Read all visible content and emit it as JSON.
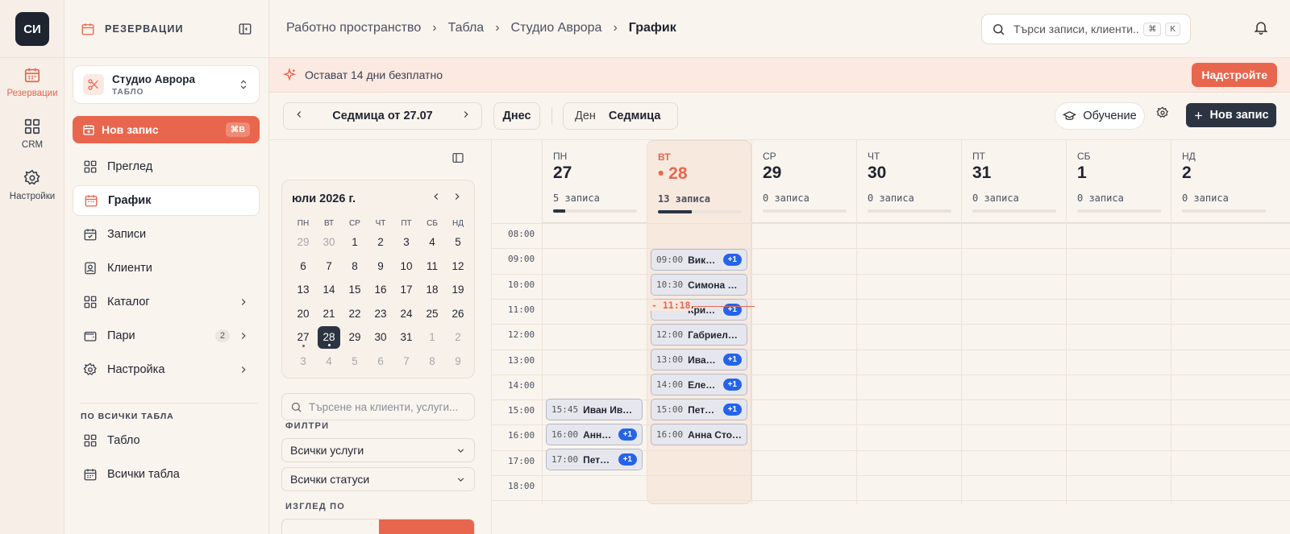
{
  "rail": {
    "logo": "СИ",
    "items": [
      {
        "label": "Резервации",
        "icon": "calendar-icon"
      },
      {
        "label": "CRM",
        "icon": "grid-icon"
      },
      {
        "label": "Настройки",
        "icon": "gear-icon"
      }
    ]
  },
  "sidebar": {
    "title": "РЕЗЕРВАЦИИ",
    "studio": {
      "name": "Студио Аврора",
      "sub": "ТАБЛО"
    },
    "new_button": {
      "label": "Нов запис",
      "shortcut": "⌘B"
    },
    "items": [
      {
        "label": "Преглед"
      },
      {
        "label": "График"
      },
      {
        "label": "Записи"
      },
      {
        "label": "Клиенти"
      },
      {
        "label": "Каталог"
      },
      {
        "label": "Пари",
        "badge": "2"
      },
      {
        "label": "Настройка"
      }
    ],
    "section_label": "ПО ВСИЧКИ ТАБЛА",
    "section_items": [
      {
        "label": "Табло"
      },
      {
        "label": "Всички табла"
      }
    ]
  },
  "breadcrumb": [
    "Работно пространство",
    "Табла",
    "Студио Аврора",
    "График"
  ],
  "search": {
    "placeholder": "Търси записи, клиенти...",
    "key1": "⌘",
    "key2": "K"
  },
  "banner": {
    "message": "Остават 14 дни безплатно",
    "upgrade": "Надстройте"
  },
  "toolbar": {
    "week_label": "Седмица от 27.07",
    "today": "Днес",
    "view_day": "Ден",
    "view_week": "Седмица",
    "learn": "Обучение",
    "new_record": "Нов запис"
  },
  "mini_calendar": {
    "title": "юли 2026 г.",
    "dow": [
      "ПН",
      "ВТ",
      "СР",
      "ЧТ",
      "ПТ",
      "СБ",
      "НД"
    ],
    "weeks": [
      [
        "29",
        "30",
        "1",
        "2",
        "3",
        "4",
        "5"
      ],
      [
        "6",
        "7",
        "8",
        "9",
        "10",
        "11",
        "12"
      ],
      [
        "13",
        "14",
        "15",
        "16",
        "17",
        "18",
        "19"
      ],
      [
        "20",
        "21",
        "22",
        "23",
        "24",
        "25",
        "26"
      ],
      [
        "27",
        "28",
        "29",
        "30",
        "31",
        "1",
        "2"
      ],
      [
        "3",
        "4",
        "5",
        "6",
        "7",
        "8",
        "9"
      ]
    ]
  },
  "client_search": {
    "placeholder": "Търсене на клиенти, услуги..."
  },
  "filters": {
    "label": "ФИЛТРИ",
    "services": "Всички услуги",
    "statuses": "Всички статуси",
    "view_by": "ИЗГЛЕД ПО"
  },
  "week": {
    "days": [
      {
        "dow": "ПН",
        "num": "27",
        "count": "5 записа",
        "load": 0.14
      },
      {
        "dow": "ВТ",
        "num": "28",
        "count": "13 записа",
        "load": 0.4
      },
      {
        "dow": "СР",
        "num": "29",
        "count": "0 записа",
        "load": 0
      },
      {
        "dow": "ЧТ",
        "num": "30",
        "count": "0 записа",
        "load": 0
      },
      {
        "dow": "ПТ",
        "num": "31",
        "count": "0 записа",
        "load": 0
      },
      {
        "dow": "СБ",
        "num": "1",
        "count": "0 записа",
        "load": 0
      },
      {
        "dow": "НД",
        "num": "2",
        "count": "0 записа",
        "load": 0
      }
    ],
    "hours": [
      "08:00",
      "09:00",
      "10:00",
      "11:00",
      "12:00",
      "13:00",
      "14:00",
      "15:00",
      "16:00",
      "17:00",
      "18:00"
    ],
    "now": "11:18",
    "events": [
      {
        "day": 1,
        "time": "09:00",
        "name": "Виктория Петрова",
        "more": "+1"
      },
      {
        "day": 1,
        "time": "10:30",
        "name": "Симона Николова",
        "more": ""
      },
      {
        "day": 1,
        "time": "11:18",
        "name": "Кристина Иванова",
        "more": "+1"
      },
      {
        "day": 1,
        "time": "12:00",
        "name": "Габриела Маринова",
        "more": ""
      },
      {
        "day": 1,
        "time": "13:00",
        "name": "Иванка Петрова",
        "more": "+1"
      },
      {
        "day": 1,
        "time": "14:00",
        "name": "Елена Димитрова",
        "more": "+1"
      },
      {
        "day": 1,
        "time": "15:00",
        "name": "Петьо Стоянов",
        "more": "+1"
      },
      {
        "day": 1,
        "time": "16:00",
        "name": "Анна Стоянова",
        "more": ""
      },
      {
        "day": 0,
        "time": "15:45",
        "name": "Иван Иванов",
        "more": ""
      },
      {
        "day": 0,
        "time": "16:00",
        "name": "Анна Петрова",
        "more": "+1"
      },
      {
        "day": 0,
        "time": "17:00",
        "name": "Петьо Георгиев",
        "more": "+1"
      }
    ]
  }
}
